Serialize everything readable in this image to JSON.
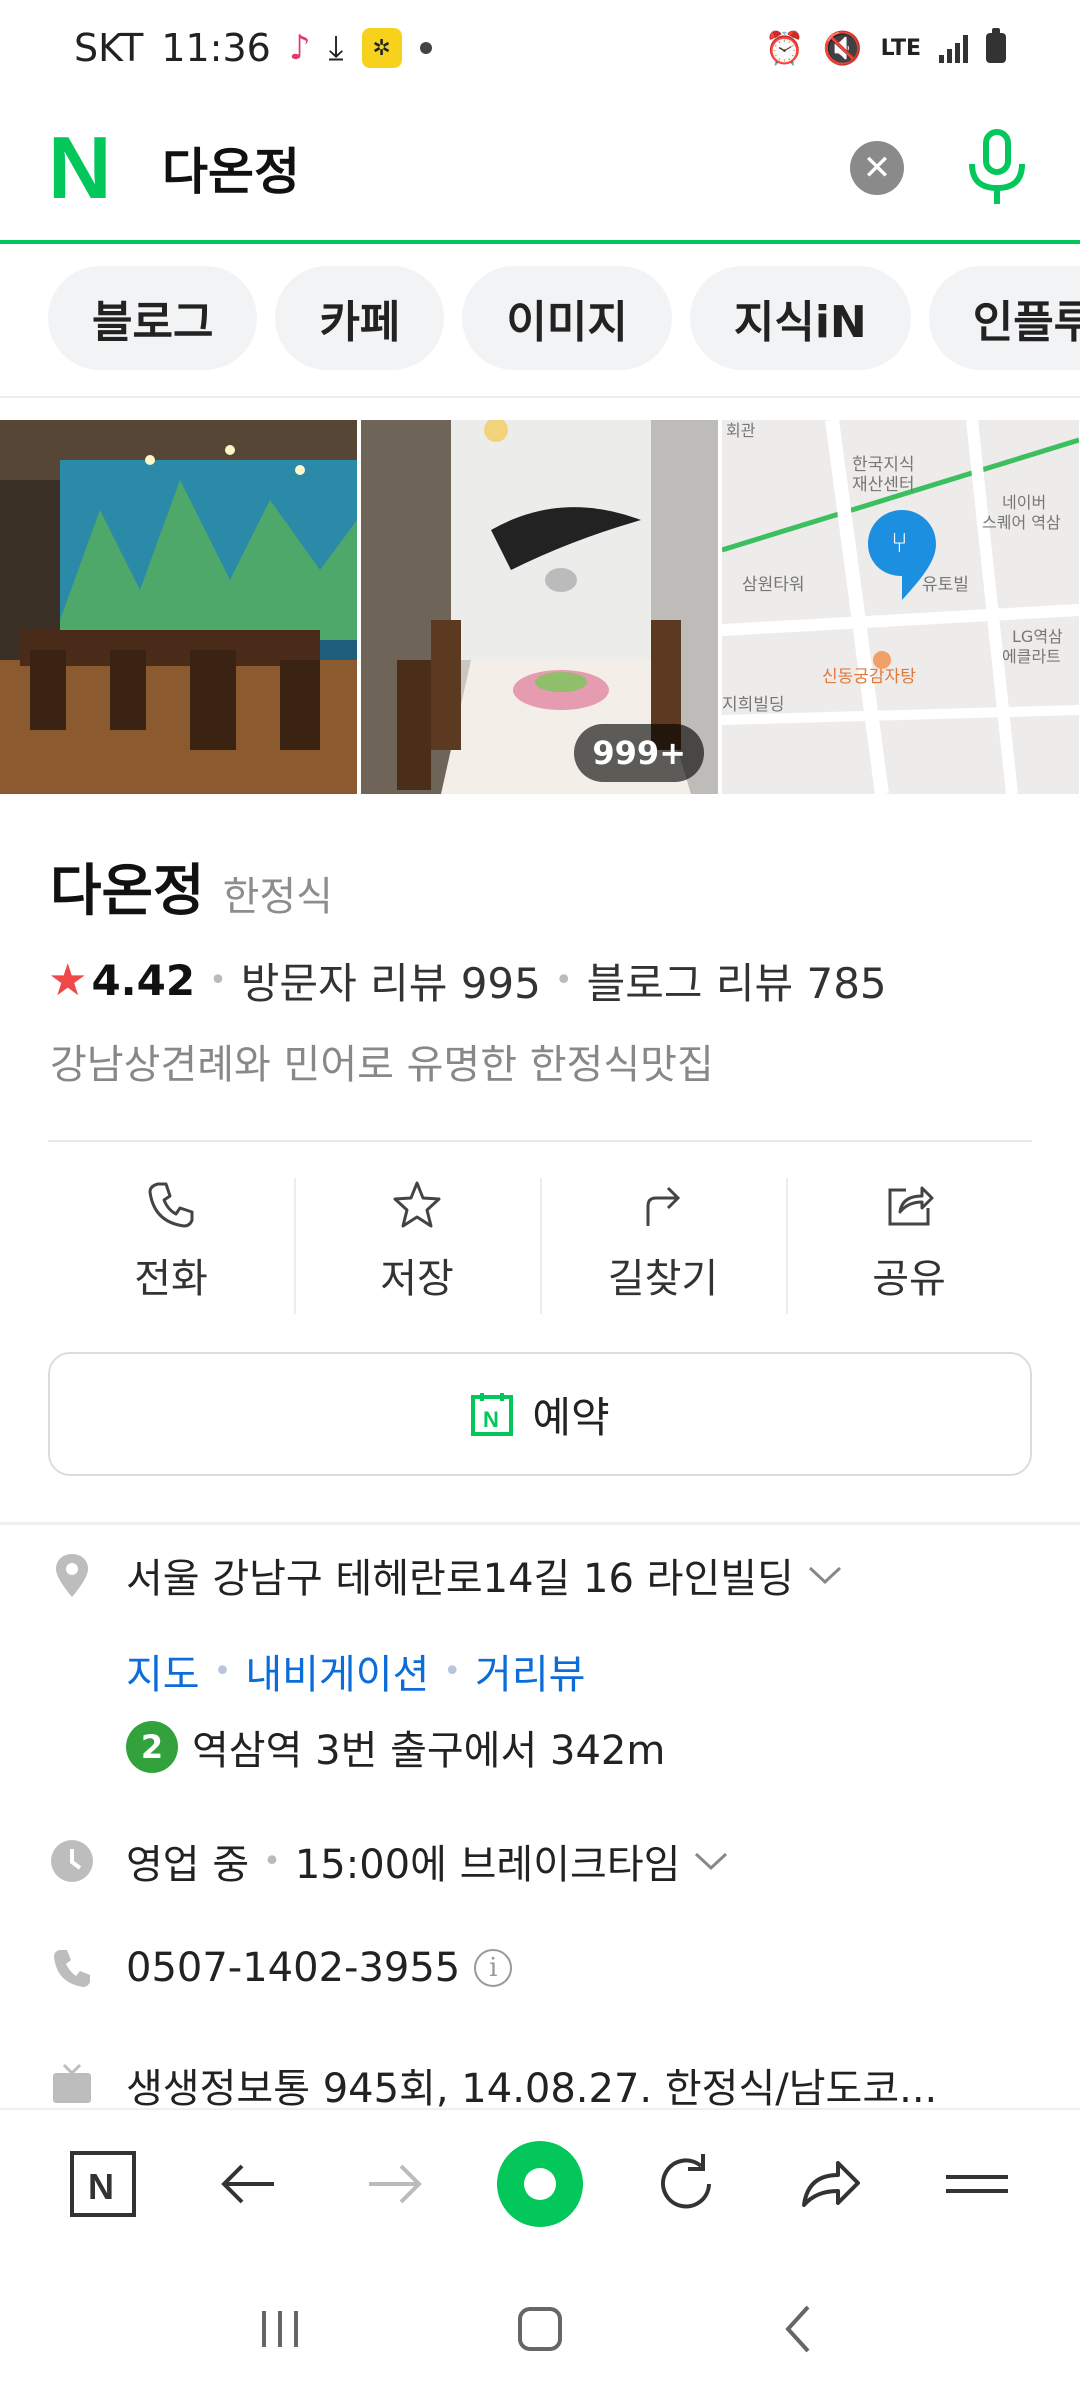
{
  "status_bar": {
    "carrier": "SKT",
    "time": "11:36",
    "network": "LTE"
  },
  "search": {
    "logo": "N",
    "query": "다온정"
  },
  "chips": [
    "블로그",
    "카페",
    "이미지",
    "지식iN",
    "인플루"
  ],
  "photos": {
    "count_badge": "999+"
  },
  "place": {
    "name": "다온정",
    "category": "한정식",
    "rating": "4.42",
    "visitor_reviews": "방문자 리뷰 995",
    "blog_reviews": "블로그 리뷰 785",
    "description": "강남상견례와 민어로 유명한 한정식맛집"
  },
  "actions": {
    "call": "전화",
    "save": "저장",
    "directions": "길찾기",
    "share": "공유"
  },
  "reserve_label": "예약",
  "details": {
    "address": "서울 강남구 테헤란로14길 16 라인빌딩",
    "links": [
      "지도",
      "내비게이션",
      "거리뷰"
    ],
    "subway_line": "2",
    "subway_text": "역삼역 3번 출구에서 342m",
    "hours_status": "영업 중",
    "hours_detail": "15:00에 브레이크타임",
    "phone": "0507-1402-3955",
    "tv_info": "생생정보통 945회, 14.08.27. 한정식/남도코..."
  },
  "map_labels": {
    "top_left": "회관",
    "center_1": "한국지식",
    "center_2": "재산센터",
    "right_1": "네이버",
    "right_2": "스퀘어 역삼",
    "left_mid": "삼원타워",
    "hotel": "유토빌",
    "lg_1": "LG역삼",
    "lg_2": "에클라트",
    "bottom_left": "지희빌딩",
    "restaurant": "신동궁감자탕"
  },
  "colors": {
    "naver_green": "#03c75a",
    "link_blue": "#0c6dd8",
    "star_red": "#f04848",
    "subway_line2": "#33a23d"
  }
}
